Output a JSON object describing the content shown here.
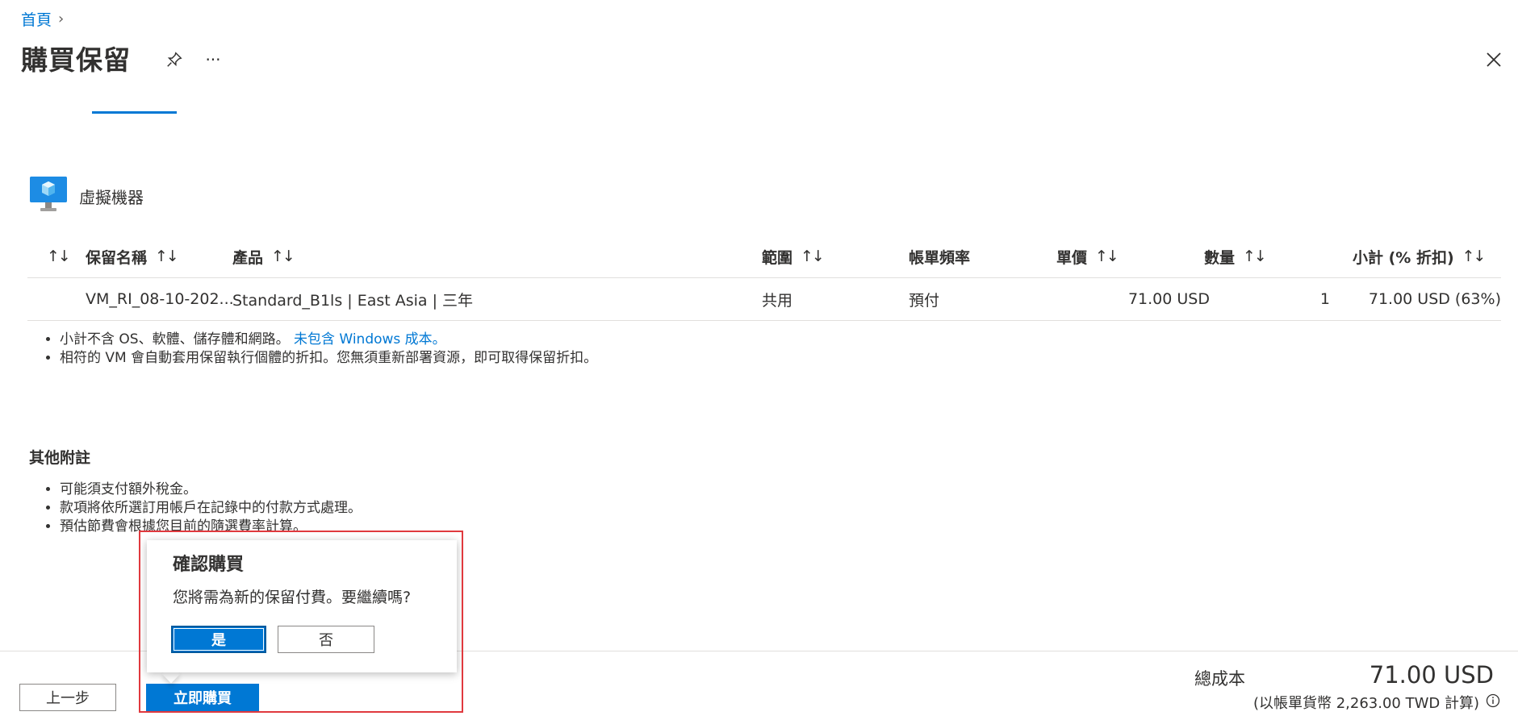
{
  "breadcrumb": {
    "home": "首頁",
    "separator": "›"
  },
  "header": {
    "title": "購買保留",
    "more": "···"
  },
  "section": {
    "label": "虛擬機器"
  },
  "table": {
    "headers": {
      "sort_all": "↑↓",
      "name": "保留名稱",
      "product": "產品",
      "scope": "範圍",
      "billing": "帳單頻率",
      "unit_price": "單價",
      "quantity": "數量",
      "subtotal": "小計 (% 折扣)"
    },
    "sort_glyph": "↑↓",
    "rows": [
      {
        "name": "VM_RI_08-10-202...",
        "product": "Standard_B1ls | East Asia | 三年",
        "scope": "共用",
        "billing": "預付",
        "unit_price": "71.00 USD",
        "quantity": "1",
        "subtotal": "71.00 USD (63%)"
      }
    ]
  },
  "notes": {
    "item1_text": "小計不含 OS、軟體、儲存體和網路。",
    "item1_link": "未包含 Windows 成本。",
    "item2": "相符的 VM 會自動套用保留執行個體的折扣。您無須重新部署資源，即可取得保留折扣。"
  },
  "other_notes": {
    "title": "其他附註",
    "items": [
      "可能須支付額外稅金。",
      "款項將依所選訂用帳戶在記錄中的付款方式處理。",
      "預估節費會根據您目前的隨選費率計算。"
    ]
  },
  "footer": {
    "prev_label": "上一步",
    "buy_label": "立即購買",
    "total_label": "總成本",
    "total_value": "71.00 USD",
    "total_note": "(以帳單貨幣 2,263.00 TWD 計算)"
  },
  "confirm": {
    "title": "確認購買",
    "message": "您將需為新的保留付費。要繼續嗎?",
    "yes_label": "是",
    "no_label": "否"
  },
  "colors": {
    "accent": "#0078d4",
    "highlight": "#e0393e"
  },
  "icons": {
    "pin": "pin-icon",
    "close": "close-icon",
    "vm": "vm-icon",
    "info": "info-icon"
  }
}
